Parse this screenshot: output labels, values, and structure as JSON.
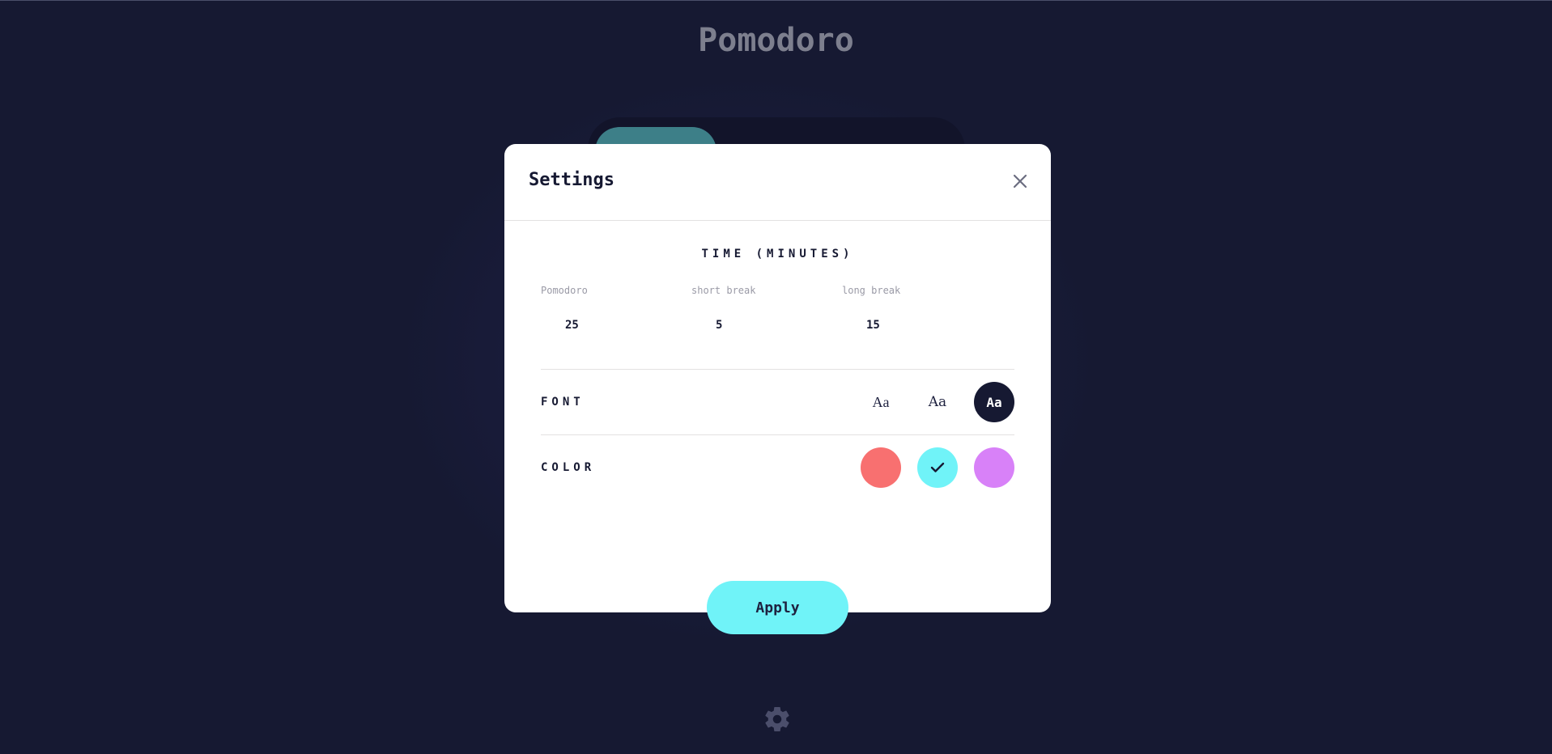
{
  "app": {
    "title": "Pomodoro"
  },
  "settings": {
    "title": "Settings",
    "time_heading": "TIME (MINUTES)",
    "fields": [
      {
        "label": "Pomodoro",
        "value": "25"
      },
      {
        "label": "short break",
        "value": "5"
      },
      {
        "label": "long break",
        "value": "15"
      }
    ],
    "font_label": "FONT",
    "font_options": [
      {
        "label": "Aa",
        "selected": false
      },
      {
        "label": "Aa",
        "selected": false
      },
      {
        "label": "Aa",
        "selected": true
      }
    ],
    "color_label": "COLOR",
    "color_options": [
      {
        "hex": "#F87070",
        "selected": false
      },
      {
        "hex": "#70F3F8",
        "selected": true
      },
      {
        "hex": "#D881F8",
        "selected": false
      }
    ],
    "apply_label": "Apply"
  },
  "theme": {
    "background": "#161932",
    "accent": "#70F3F8",
    "dark": "#161932",
    "icons": {
      "close": "close-icon",
      "check": "check-icon",
      "settings": "gear-icon"
    }
  }
}
